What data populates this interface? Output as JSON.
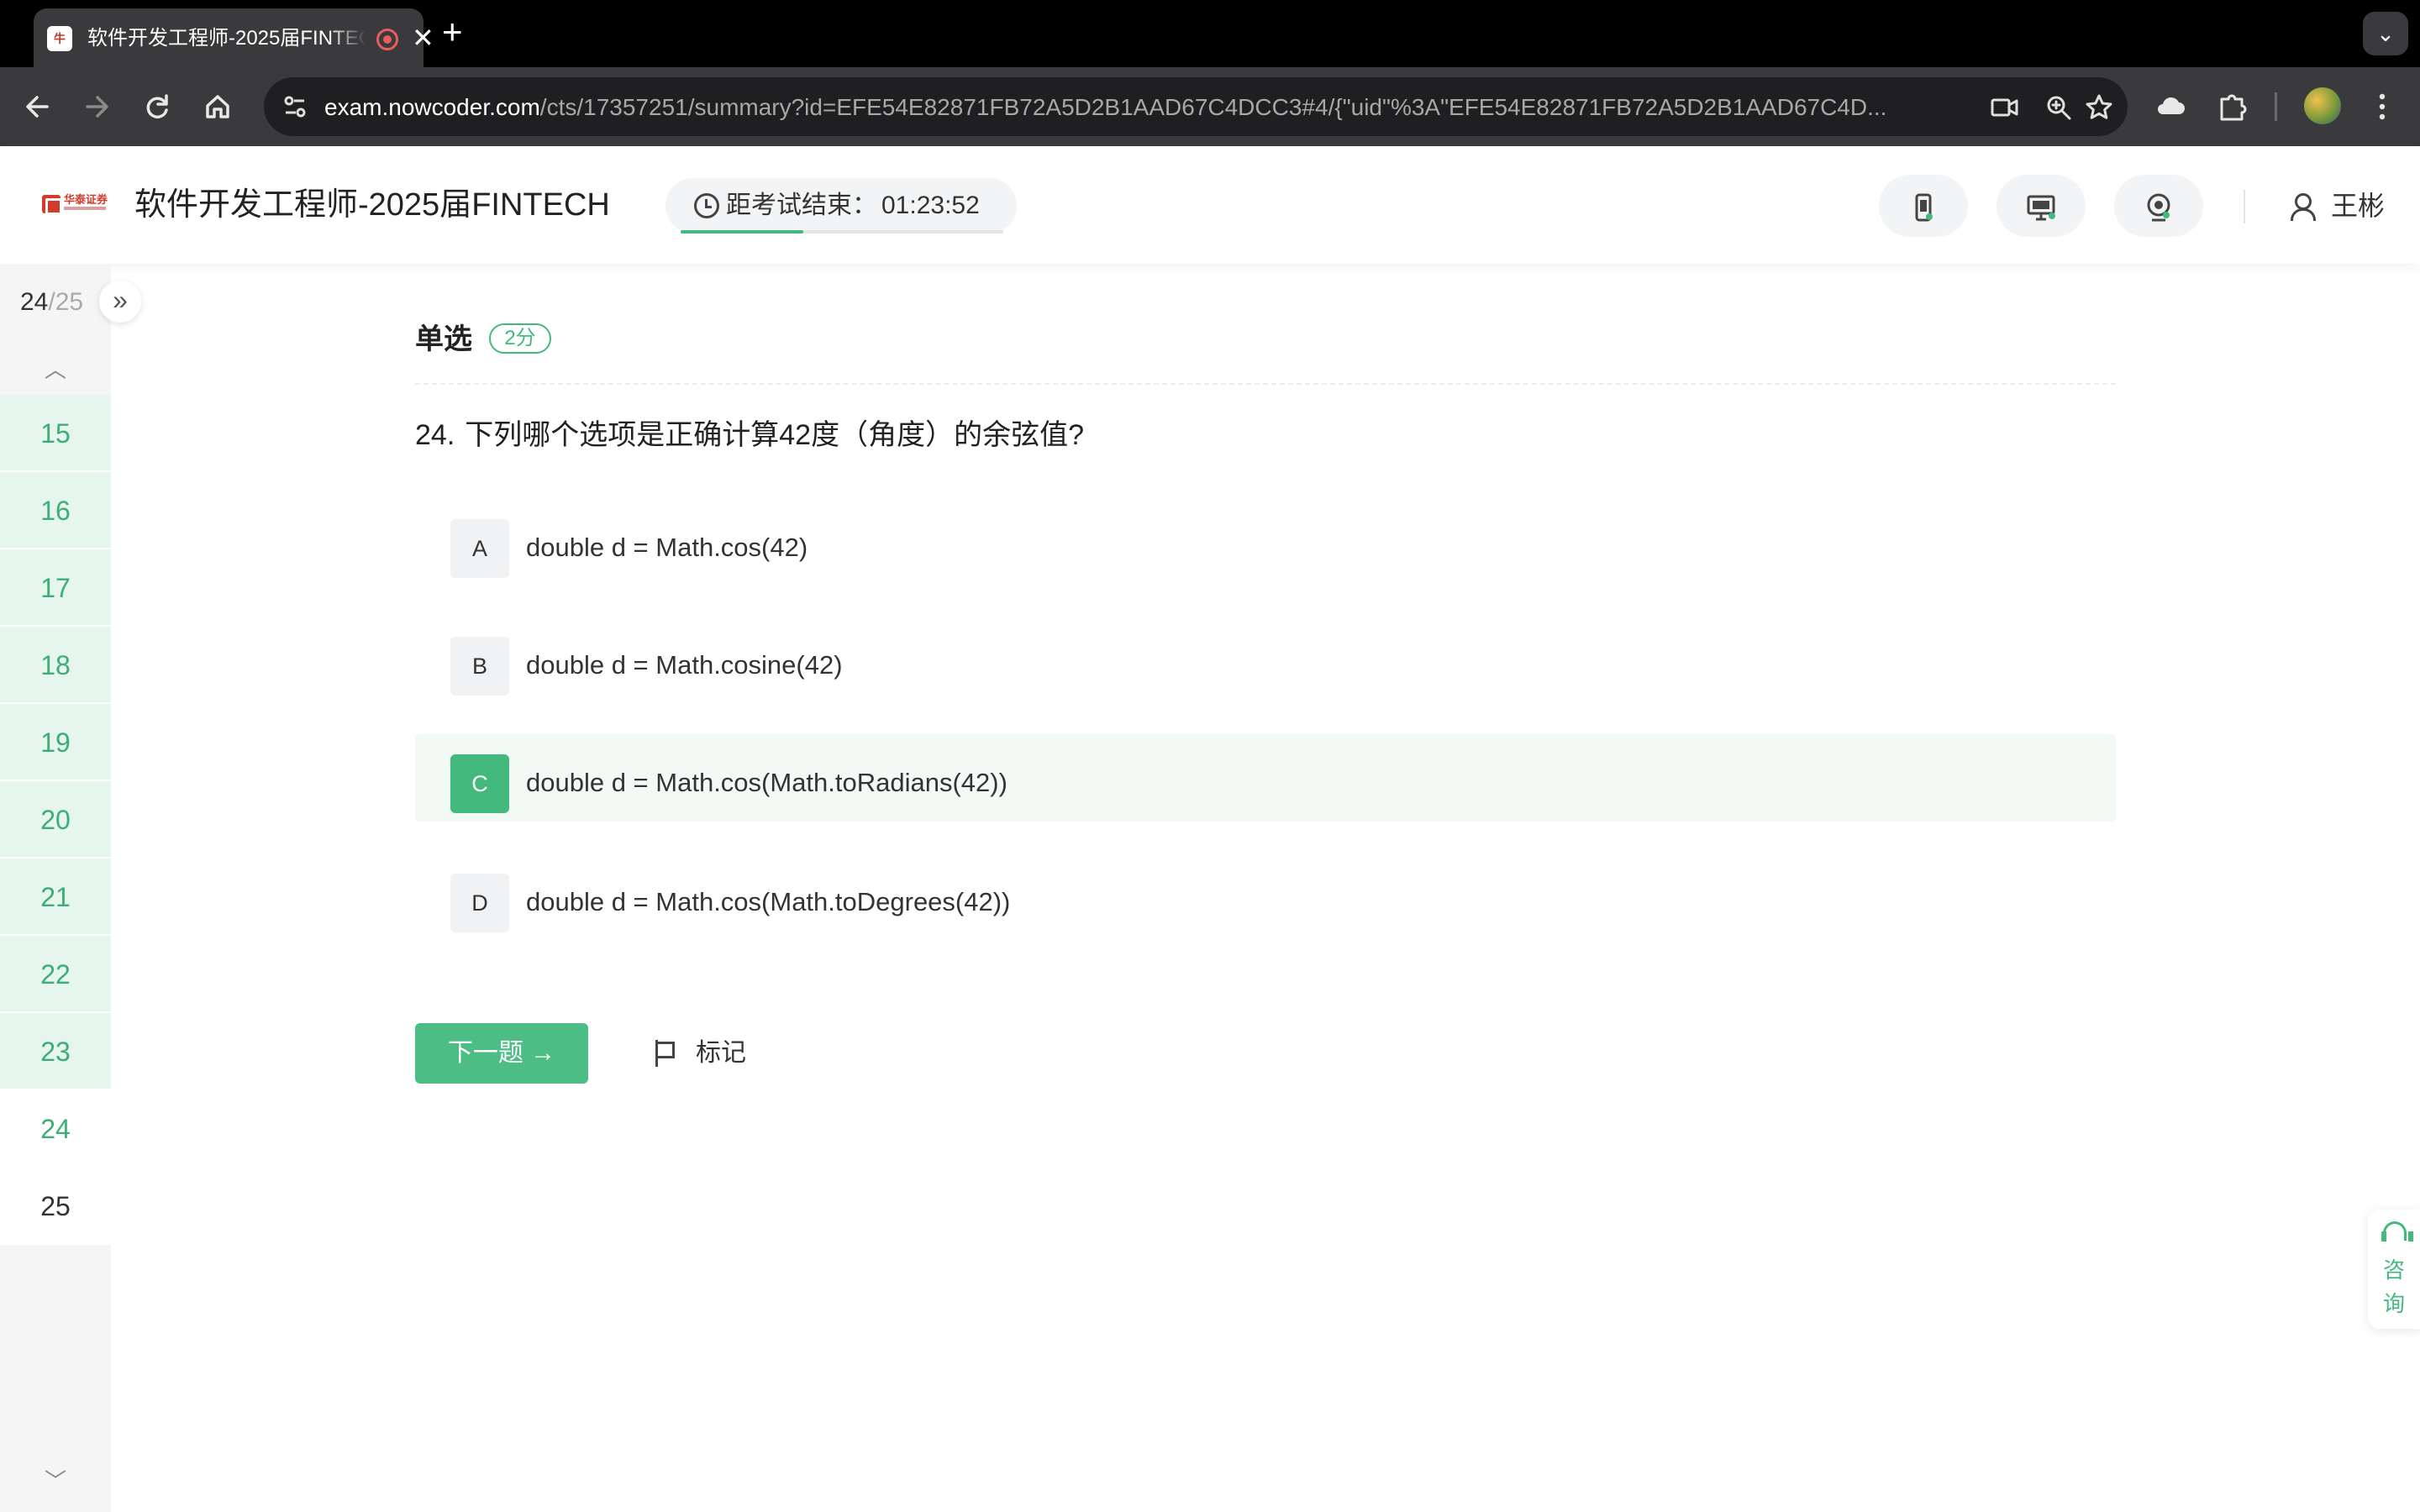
{
  "browser": {
    "tab_title": "软件开发工程师-2025届FINTECH",
    "url_host": "exam.nowcoder.com",
    "url_path": "/cts/17357251/summary?id=EFE54E82871FB72A5D2B1AAD67C4DCC3#4/{\"uid\"%3A\"EFE54E82871FB72A5D2B1AAD67C4D...",
    "favicon_text": "牛",
    "tab_close": "✕",
    "new_tab": "+",
    "tab_menu": "⌄",
    "icons": {
      "back": "arrow-left-icon",
      "forward": "arrow-right-icon",
      "reload": "reload-icon",
      "home": "home-icon",
      "site_info": "tune-icon",
      "camera": "video-camera-icon",
      "zoom": "zoom-icon",
      "bookmark": "star-icon",
      "cloud": "cloud-icon",
      "extensions": "puzzle-icon",
      "menu": "kebab-menu-icon"
    }
  },
  "header": {
    "logo_text": "华泰证券",
    "exam_title": "软件开发工程师-2025届FINTECH",
    "timer_label": "距考试结束：",
    "timer_value": "01:23:52",
    "timer_progress": 0.38,
    "monitor_icons": [
      "phone-monitor-icon",
      "screen-monitor-icon",
      "camera-monitor-icon"
    ],
    "user_name": "王彬"
  },
  "sidebar": {
    "current": "24",
    "separator": "/",
    "total": "25",
    "expand_glyph": "»",
    "up_glyph": "︿",
    "down_glyph": "﹀",
    "items": [
      {
        "label": "15",
        "state": "answered"
      },
      {
        "label": "16",
        "state": "answered"
      },
      {
        "label": "17",
        "state": "answered"
      },
      {
        "label": "18",
        "state": "answered"
      },
      {
        "label": "19",
        "state": "answered"
      },
      {
        "label": "20",
        "state": "answered"
      },
      {
        "label": "21",
        "state": "answered"
      },
      {
        "label": "22",
        "state": "answered"
      },
      {
        "label": "23",
        "state": "answered"
      },
      {
        "label": "24",
        "state": "current"
      },
      {
        "label": "25",
        "state": "pending"
      }
    ]
  },
  "question": {
    "type": "单选",
    "score": "2分",
    "number": "24.",
    "text": "下列哪个选项是正确计算42度（角度）的余弦值?",
    "options": [
      {
        "key": "A",
        "text": "double d = Math.cos(42)",
        "selected": false
      },
      {
        "key": "B",
        "text": "double d = Math.cosine(42)",
        "selected": false
      },
      {
        "key": "C",
        "text": "double d = Math.cos(Math.toRadians(42))",
        "selected": true
      },
      {
        "key": "D",
        "text": "double d = Math.cos(Math.toDegrees(42))",
        "selected": false
      }
    ]
  },
  "actions": {
    "next_label": "下一题 →",
    "mark_label": "标记"
  },
  "consult": {
    "line1": "咨",
    "line2": "询"
  },
  "colors": {
    "accent": "#43b97e",
    "accent_light": "#e6f5ed",
    "text": "#333333",
    "chrome_dark": "#3a3a3c"
  }
}
